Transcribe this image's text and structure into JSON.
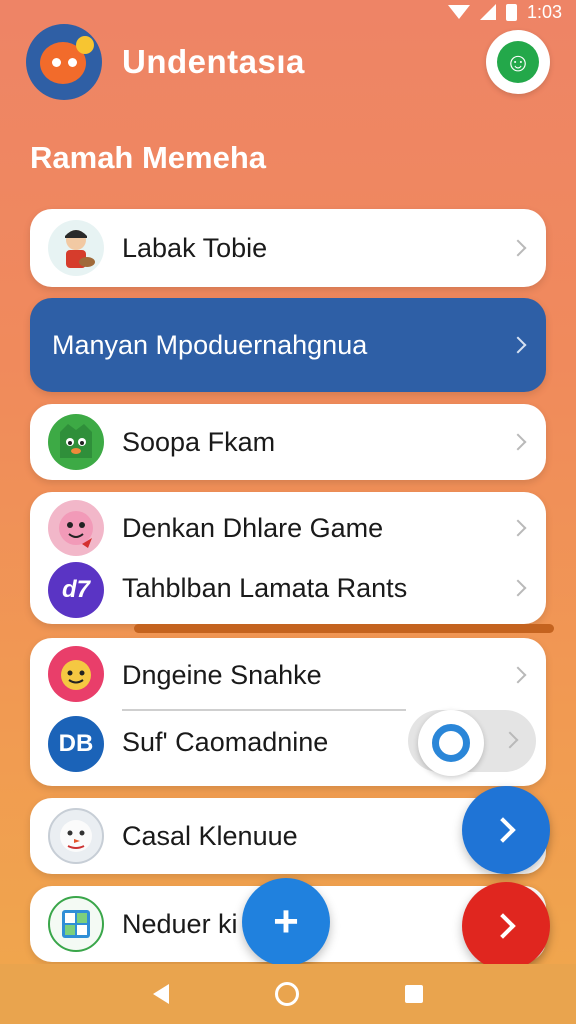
{
  "status": {
    "time": "1:03"
  },
  "header": {
    "app_name": "Undentasıa"
  },
  "section": {
    "title": "Ramah Memeha"
  },
  "items": [
    {
      "label": "Labak Tobie",
      "avatar": "kid-icon",
      "avatar_color": "#e7f3f3"
    },
    {
      "label": "Manyan Mpoduernahgnua",
      "selected": true
    },
    {
      "label": "Soopa Fkam",
      "avatar": "green-monster-icon",
      "avatar_color": "#3daa45"
    },
    {
      "label": "Denkan Dhlare Game",
      "avatar": "pink-face-icon",
      "avatar_color": "#f2b7c9"
    },
    {
      "label": "Tahblban Lamata Rants",
      "avatar": "d7-logo",
      "avatar_text": "d7",
      "avatar_color": "#5a34c4"
    },
    {
      "label": "Dngeine Snahke",
      "avatar": "yellow-face-icon",
      "avatar_color": "#f5c842"
    },
    {
      "label": "Suf' Caomadnine",
      "avatar": "db-logo",
      "avatar_text": "DB",
      "avatar_color": "#1b63b8",
      "toggle_on": true
    },
    {
      "label": "Casal Klenuue",
      "avatar": "snowman-icon",
      "avatar_color": "#eaeef2"
    },
    {
      "label": "Neduer ki",
      "avatar": "grid-app-icon",
      "avatar_color": "#f4faf4"
    }
  ],
  "colors": {
    "accent": "#2e5fa6",
    "fab_blue": "#1f74d6",
    "fab_red": "#e0261f"
  },
  "fab": {
    "add": "+"
  }
}
